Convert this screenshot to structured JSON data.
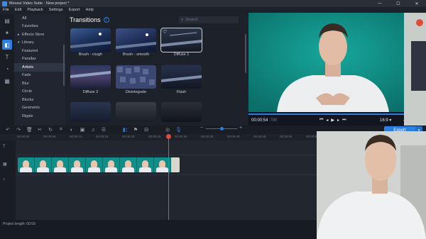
{
  "window": {
    "title": "Movavi Video Suite - New project *",
    "min": "—",
    "max": "☐",
    "close": "✕"
  },
  "menu": [
    "File",
    "Edit",
    "Playback",
    "Settings",
    "Export",
    "Help"
  ],
  "categories": [
    {
      "label": "All",
      "state": ""
    },
    {
      "label": "Favorites",
      "state": ""
    },
    {
      "label": "Effects Store",
      "state": "exp"
    },
    {
      "label": "Library",
      "state": "open"
    },
    {
      "label": "Featured",
      "state": ""
    },
    {
      "label": "Parallax",
      "state": ""
    },
    {
      "label": "Artistic",
      "state": "sel"
    },
    {
      "label": "Fade",
      "state": ""
    },
    {
      "label": "Blur",
      "state": ""
    },
    {
      "label": "Circle",
      "state": ""
    },
    {
      "label": "Blocks",
      "state": ""
    },
    {
      "label": "Geometric",
      "state": ""
    },
    {
      "label": "Ripple",
      "state": ""
    }
  ],
  "transitions": {
    "title": "Transitions",
    "help": "?",
    "search_placeholder": "Search",
    "items": [
      "Brush - rough",
      "Brush - smooth",
      "Diffuse 1",
      "Diffuse 2",
      "Disintegrate",
      "Flash"
    ]
  },
  "player": {
    "timecode": "00:00:54",
    "timecode_frames": "780",
    "aspect": "16:9 ▾",
    "progress": 0.96
  },
  "timeline": {
    "export_label": "Export",
    "ruler": [
      "00:00:00",
      "00:00:05",
      "00:00:10",
      "00:00:15",
      "00:00:20",
      "00:00:25",
      "00:00:30",
      "00:00:35",
      "00:00:40",
      "00:00:45",
      "00:00:50",
      "00:00:55",
      "00:01:00",
      "00:01:05",
      "00:01:10",
      "00:01:15"
    ],
    "zoom_level": 0.5
  },
  "status": {
    "project_length": "Project length: 00:59"
  },
  "colors": {
    "accent": "#2b7fe0",
    "playhead": "#e04a3a",
    "clip": "#0e8f89"
  }
}
